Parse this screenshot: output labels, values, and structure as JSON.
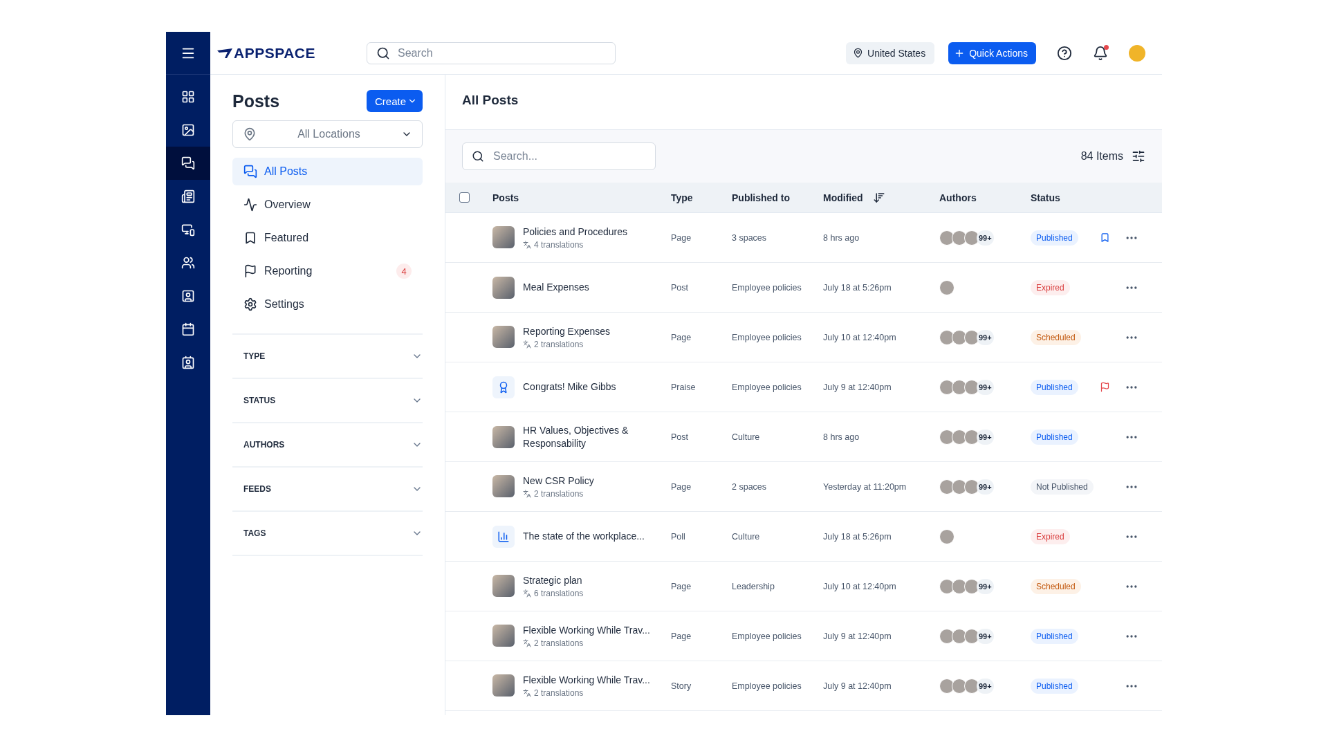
{
  "rail": {
    "items": [
      {
        "selected": false
      },
      {
        "selected": false
      },
      {
        "selected": true
      },
      {
        "selected": false
      },
      {
        "selected": false
      },
      {
        "selected": false
      },
      {
        "selected": false
      },
      {
        "selected": false
      },
      {
        "selected": false
      }
    ]
  },
  "header": {
    "logo": "APPSPACE",
    "search_placeholder": "Search",
    "location": "United States",
    "quick_actions": "Quick Actions",
    "notifications_unread": true
  },
  "sidebar": {
    "title": "Posts",
    "create": "Create",
    "location_filter": "All Locations",
    "nav": [
      {
        "label": "All Posts",
        "selected": true
      },
      {
        "label": "Overview",
        "selected": false
      },
      {
        "label": "Featured",
        "selected": false
      },
      {
        "label": "Reporting",
        "selected": false,
        "badge": "4"
      },
      {
        "label": "Settings",
        "selected": false
      }
    ],
    "filters": [
      {
        "label": "TYPE",
        "expanded": false
      },
      {
        "label": "STATUS",
        "expanded": false
      },
      {
        "label": "AUTHORS",
        "expanded": false
      },
      {
        "label": "FEEDS",
        "expanded": false
      },
      {
        "label": "TAGS",
        "expanded": false
      }
    ]
  },
  "main": {
    "title": "All Posts",
    "search_placeholder": "Search...",
    "count": "84 Items",
    "table": {
      "select_all_checked": false,
      "columns": [
        {
          "label": "Posts"
        },
        {
          "label": "Type"
        },
        {
          "label": "Published to"
        },
        {
          "label": "Modified",
          "sorted": true
        },
        {
          "label": "Authors"
        },
        {
          "label": "Status"
        }
      ],
      "rows": [
        {
          "thumb": {
            "kind": "photo"
          },
          "title": "Policies and Procedures",
          "translations": "4 translations",
          "type": "Page",
          "published_to": "3 spaces",
          "modified": "8 hrs ago",
          "authors": [
            {
              "kind": "photo"
            },
            {
              "kind": "photo"
            },
            {
              "kind": "photo"
            }
          ],
          "authors_more": "99+",
          "status": {
            "kind": "published",
            "label": "Published"
          },
          "marker": {
            "kind": "bookmark"
          }
        },
        {
          "thumb": {
            "kind": "photo"
          },
          "title": "Meal Expenses",
          "type": "Post",
          "published_to": "Employee policies",
          "modified": "July 18 at 5:26pm",
          "authors": [
            {
              "kind": "photo"
            }
          ],
          "status": {
            "kind": "expired",
            "label": "Expired"
          }
        },
        {
          "thumb": {
            "kind": "photo"
          },
          "title": "Reporting Expenses",
          "translations": "2 translations",
          "type": "Page",
          "published_to": "Employee policies",
          "modified": "July 10 at 12:40pm",
          "authors": [
            {
              "kind": "photo"
            },
            {
              "kind": "photo"
            },
            {
              "kind": "photo"
            }
          ],
          "authors_more": "99+",
          "status": {
            "kind": "scheduled",
            "label": "Scheduled"
          }
        },
        {
          "thumb": {
            "kind": "praise"
          },
          "title": "Congrats! Mike Gibbs",
          "type": "Praise",
          "published_to": "Employee policies",
          "modified": "July 9 at 12:40pm",
          "authors": [
            {
              "kind": "photo"
            },
            {
              "kind": "photo"
            },
            {
              "kind": "photo"
            }
          ],
          "authors_more": "99+",
          "status": {
            "kind": "published",
            "label": "Published"
          },
          "marker": {
            "kind": "flag"
          }
        },
        {
          "thumb": {
            "kind": "photo"
          },
          "title": "HR Values, Objectives & Responsability",
          "type": "Post",
          "published_to": "Culture",
          "modified": "8 hrs ago",
          "authors": [
            {
              "kind": "photo"
            },
            {
              "kind": "photo"
            },
            {
              "kind": "photo"
            }
          ],
          "authors_more": "99+",
          "status": {
            "kind": "published",
            "label": "Published"
          }
        },
        {
          "thumb": {
            "kind": "photo"
          },
          "title": "New CSR Policy",
          "translations": "2 translations",
          "type": "Page",
          "published_to": "2 spaces",
          "modified": "Yesterday at 11:20pm",
          "authors": [
            {
              "kind": "photo"
            },
            {
              "kind": "photo"
            },
            {
              "kind": "photo"
            }
          ],
          "authors_more": "99+",
          "status": {
            "kind": "not_published",
            "label": "Not Published"
          }
        },
        {
          "thumb": {
            "kind": "poll"
          },
          "title": "The state of the workplace...",
          "type": "Poll",
          "published_to": "Culture",
          "modified": "July 18 at 5:26pm",
          "authors": [
            {
              "kind": "photo"
            }
          ],
          "status": {
            "kind": "expired",
            "label": "Expired"
          }
        },
        {
          "thumb": {
            "kind": "photo"
          },
          "title": "Strategic plan",
          "translations": "6 translations",
          "type": "Page",
          "published_to": "Leadership",
          "modified": "July 10 at 12:40pm",
          "authors": [
            {
              "kind": "photo"
            },
            {
              "kind": "photo"
            },
            {
              "kind": "photo"
            }
          ],
          "authors_more": "99+",
          "status": {
            "kind": "scheduled",
            "label": "Scheduled"
          }
        },
        {
          "thumb": {
            "kind": "photo"
          },
          "title": "Flexible Working While Trav...",
          "translations": "2 translations",
          "type": "Page",
          "published_to": "Employee policies",
          "modified": "July 9 at 12:40pm",
          "authors": [
            {
              "kind": "photo"
            },
            {
              "kind": "photo"
            },
            {
              "kind": "photo"
            }
          ],
          "authors_more": "99+",
          "status": {
            "kind": "published",
            "label": "Published"
          }
        },
        {
          "thumb": {
            "kind": "photo"
          },
          "title": "Flexible Working While Trav...",
          "translations": "2 translations",
          "type": "Story",
          "published_to": "Employee policies",
          "modified": "July 9 at 12:40pm",
          "authors": [
            {
              "kind": "photo"
            },
            {
              "kind": "photo"
            },
            {
              "kind": "photo"
            }
          ],
          "authors_more": "99+",
          "status": {
            "kind": "published",
            "label": "Published"
          }
        }
      ]
    }
  }
}
